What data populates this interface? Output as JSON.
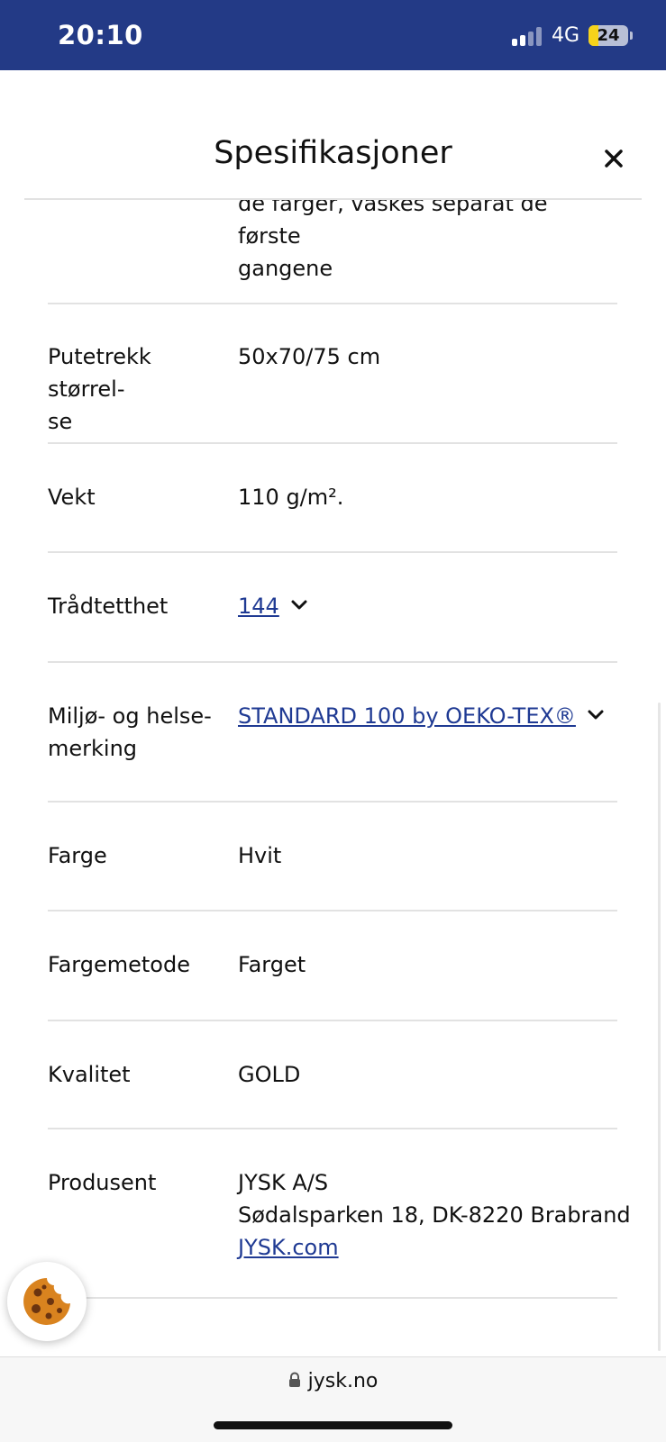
{
  "status_bar": {
    "time": "20:10",
    "network": "4G",
    "battery": "24",
    "battery_level": 0.24,
    "signal_bars_active": 2,
    "signal_bars_total": 4,
    "background_color": "#233a86"
  },
  "modal": {
    "title": "Spesifikasjoner",
    "close_icon": "close-icon"
  },
  "specs": {
    "partial_value_line1": "de farger, vaskes separat de første",
    "partial_value_line2": "gangene",
    "rows": [
      {
        "label_line1": "Putetrekk størrel-",
        "label_line2": "se",
        "value": "50x70/75 cm"
      },
      {
        "label_line1": "Vekt",
        "value": "110 g/m²."
      },
      {
        "label_line1": "Trådtetthet",
        "value": "144",
        "is_link": true,
        "has_chevron": true
      },
      {
        "label_line1": "Miljø- og helse-",
        "label_line2": "merking",
        "value": "STANDARD 100 by OEKO-TEX®",
        "is_link": true,
        "has_chevron": true
      },
      {
        "label_line1": "Farge",
        "value": "Hvit"
      },
      {
        "label_line1": "Fargemetode",
        "value": "Farget"
      },
      {
        "label_line1": "Kvalitet",
        "value": "GOLD"
      },
      {
        "label_line1": "Produsent",
        "value_line1": "JYSK A/S",
        "value_line2": "Sødalsparken 18, DK-8220 Brabrand",
        "value_link": "JYSK.com"
      }
    ]
  },
  "cookie_button": {
    "icon": "cookie-icon"
  },
  "browser": {
    "url": "jysk.no",
    "lock_icon": "lock-icon"
  },
  "colors": {
    "link": "#1f3a93",
    "divider": "#e2e2e2"
  }
}
